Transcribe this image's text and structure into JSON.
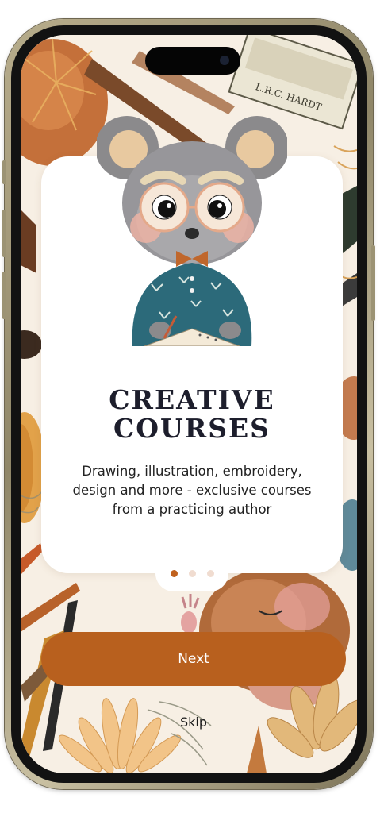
{
  "onboarding": {
    "title_line1": "CREATIVE",
    "title_line2": "COURSES",
    "description": "Drawing, illustration, embroidery, design and more - exclusive courses from a practicing author",
    "next_label": "Next",
    "skip_label": "Skip",
    "pagination": {
      "total": 3,
      "active": 1
    }
  },
  "colors": {
    "accent": "#b8601e",
    "title": "#1d1e2c",
    "background": "#f7efe4",
    "card": "#ffffff"
  },
  "illustration": {
    "subject": "mouse-with-glasses-writing-icon",
    "background": "hand-drawn-art-supplies-pattern"
  }
}
